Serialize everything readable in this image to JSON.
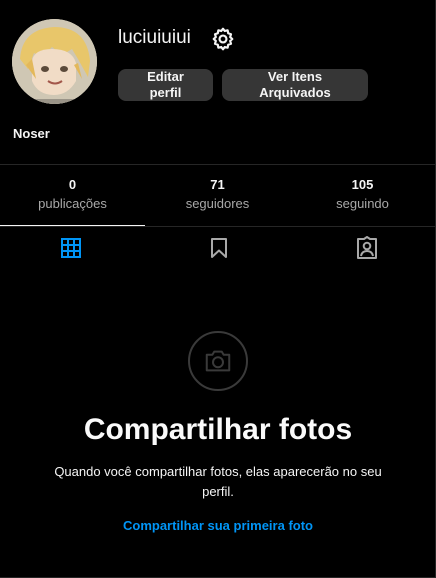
{
  "profile": {
    "username": "luciuiuiui",
    "display_name": "Noser",
    "avatar_icon": "avatar-illustration",
    "settings_icon": "gear-icon"
  },
  "actions": {
    "edit_line1": "Editar",
    "edit_line2": "perfil",
    "archive_line1": "Ver Itens",
    "archive_line2": "Arquivados"
  },
  "stats": [
    {
      "value": "0",
      "label": "publicações"
    },
    {
      "value": "71",
      "label": "seguidores"
    },
    {
      "value": "105",
      "label": "seguindo"
    }
  ],
  "tabs": [
    {
      "icon": "grid-icon",
      "active": true
    },
    {
      "icon": "bookmark-icon",
      "active": false
    },
    {
      "icon": "tagged-user-icon",
      "active": false
    }
  ],
  "empty_state": {
    "icon": "camera-icon",
    "title": "Compartilhar fotos",
    "description_line1": "Quando você compartilhar fotos, elas aparecerão no seu",
    "description_line2": "perfil.",
    "link": "Compartilhar sua primeira foto"
  },
  "colors": {
    "background": "#000000",
    "button": "#363636",
    "accent": "#0095f6",
    "divider": "#262626",
    "muted_text": "#a8a8a8"
  }
}
